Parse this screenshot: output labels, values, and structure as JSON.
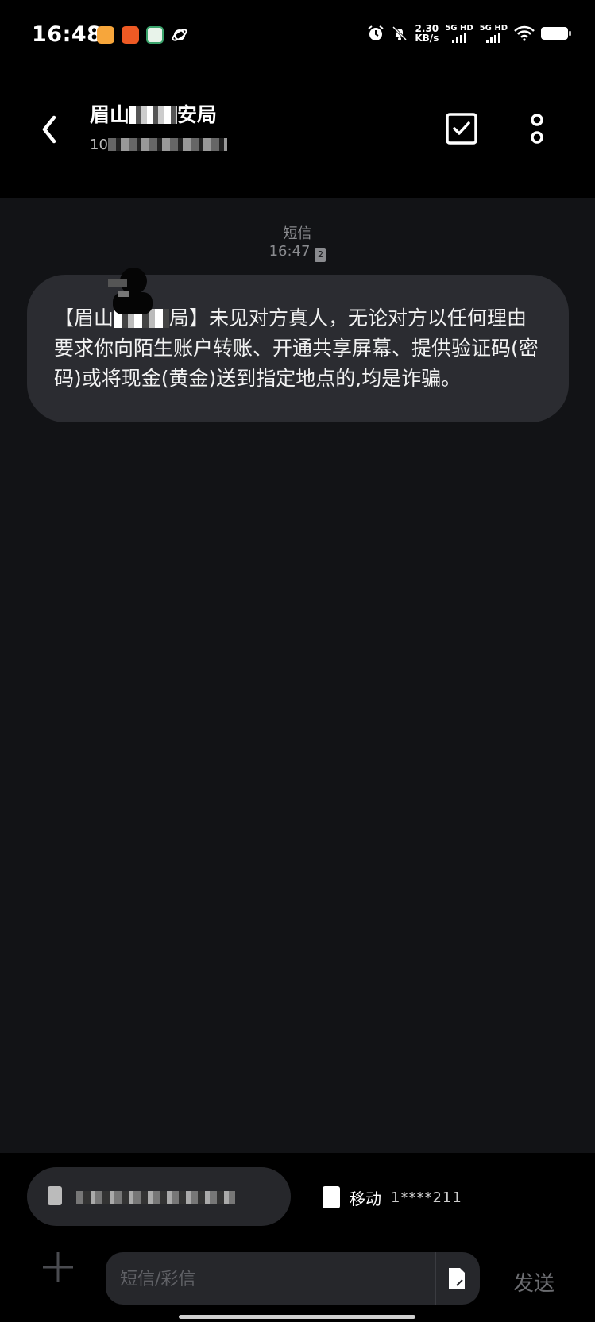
{
  "status_bar": {
    "time": "16:48",
    "app_icons": [
      "video-app-icon",
      "shopping-app-icon",
      "shield-app-icon",
      "planet-app-icon"
    ],
    "net_speed_value": "2.30",
    "net_speed_unit": "KB/s",
    "sim1": "5G HD",
    "sim2": "5G HD",
    "icons": [
      "alarm-icon",
      "mute-icon",
      "wifi-icon",
      "battery-icon"
    ]
  },
  "header": {
    "contact_name_part1": "眉山",
    "contact_name_part2": "安局",
    "contact_number_prefix": "10"
  },
  "conversation": {
    "channel_label": "短信",
    "time": "16:47",
    "sim_badge": "2",
    "message_part1": "【眉山",
    "message_part2": "局】未见对方真人，无论对方以任何理由要求你向陌生账户转账、开通共享屏幕、提供验证码(密码)或将现金(黄金)送到指定地点的,均是诈骗。"
  },
  "composer": {
    "sim2_carrier": "移动",
    "sim2_number": "1****211",
    "placeholder": "短信/彩信",
    "send_label": "发送"
  },
  "colors": {
    "background": "#121316",
    "header": "#000000",
    "bubble": "#2b2c31",
    "muted_text": "#8a8b8f"
  }
}
